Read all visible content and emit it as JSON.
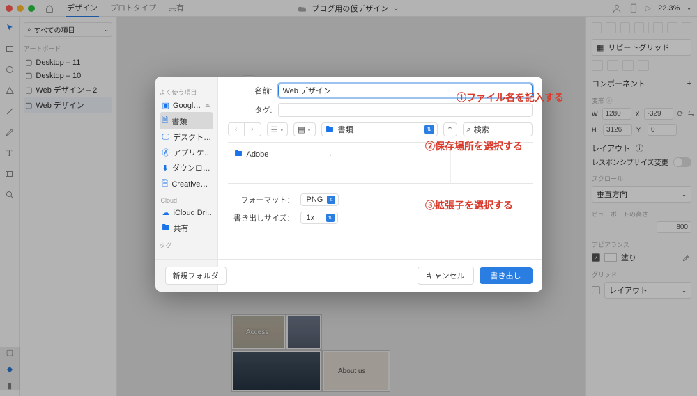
{
  "topbar": {
    "tabs": {
      "design": "デザイン",
      "prototype": "プロトタイプ",
      "share": "共有"
    },
    "doc_title": "ブログ用の仮デザイン",
    "title_caret": "⌄",
    "zoom": "22.3%",
    "play": "▷"
  },
  "left": {
    "search_placeholder": "すべての項目",
    "artboard_header": "アートボード",
    "items": {
      "d11": "Desktop – 11",
      "d10": "Desktop – 10",
      "web2": "Web デザイン – 2",
      "web": "Web デザイン"
    }
  },
  "save": {
    "sidebar": {
      "fav_header": "よく使う項目",
      "google": "Googl…",
      "docs": "書類",
      "desktop": "デスクト…",
      "apps": "アプリケ…",
      "downloads": "ダウンロ…",
      "creative": "Creative…",
      "icloud_header": "iCloud",
      "icloud_drive": "iCloud Dri…",
      "shared": "共有",
      "tags_header": "タグ"
    },
    "name_label": "名前:",
    "name_value": "Web デザイン",
    "tag_label": "タグ:",
    "path_label": "書類",
    "search_placeholder": "検索",
    "browser_item": "Adobe",
    "format_label": "フォーマット：",
    "format_value": "PNG",
    "size_label": "書き出しサイズ：",
    "size_value": "1x",
    "footer": {
      "new_folder": "新規フォルダ",
      "cancel": "キャンセル",
      "export": "書き出し"
    }
  },
  "right": {
    "repeat_grid": "リピートグリッド",
    "component_header": "コンポーネント",
    "w": "W",
    "w_val": "1280",
    "x": "X",
    "x_val": "-329",
    "h": "H",
    "h_val": "3126",
    "y": "Y",
    "y_val": "0",
    "layout_header": "レイアウト",
    "responsive": "レスポンシブサイズ変更",
    "scroll_header": "スクロール",
    "scroll_value": "垂直方向",
    "viewport_header": "ビューポートの高さ",
    "viewport_value": "800",
    "appearance_header": "アピアランス",
    "fill": "塗り",
    "grid_header": "グリッド",
    "grid_value": "レイアウト"
  },
  "annotations": {
    "a1": "①ファイル名を記入する",
    "a2": "②保存場所を選択する",
    "a3": "③拡張子を選択する"
  },
  "canvas": {
    "thumb1": "Access",
    "thumb2": "About us"
  }
}
